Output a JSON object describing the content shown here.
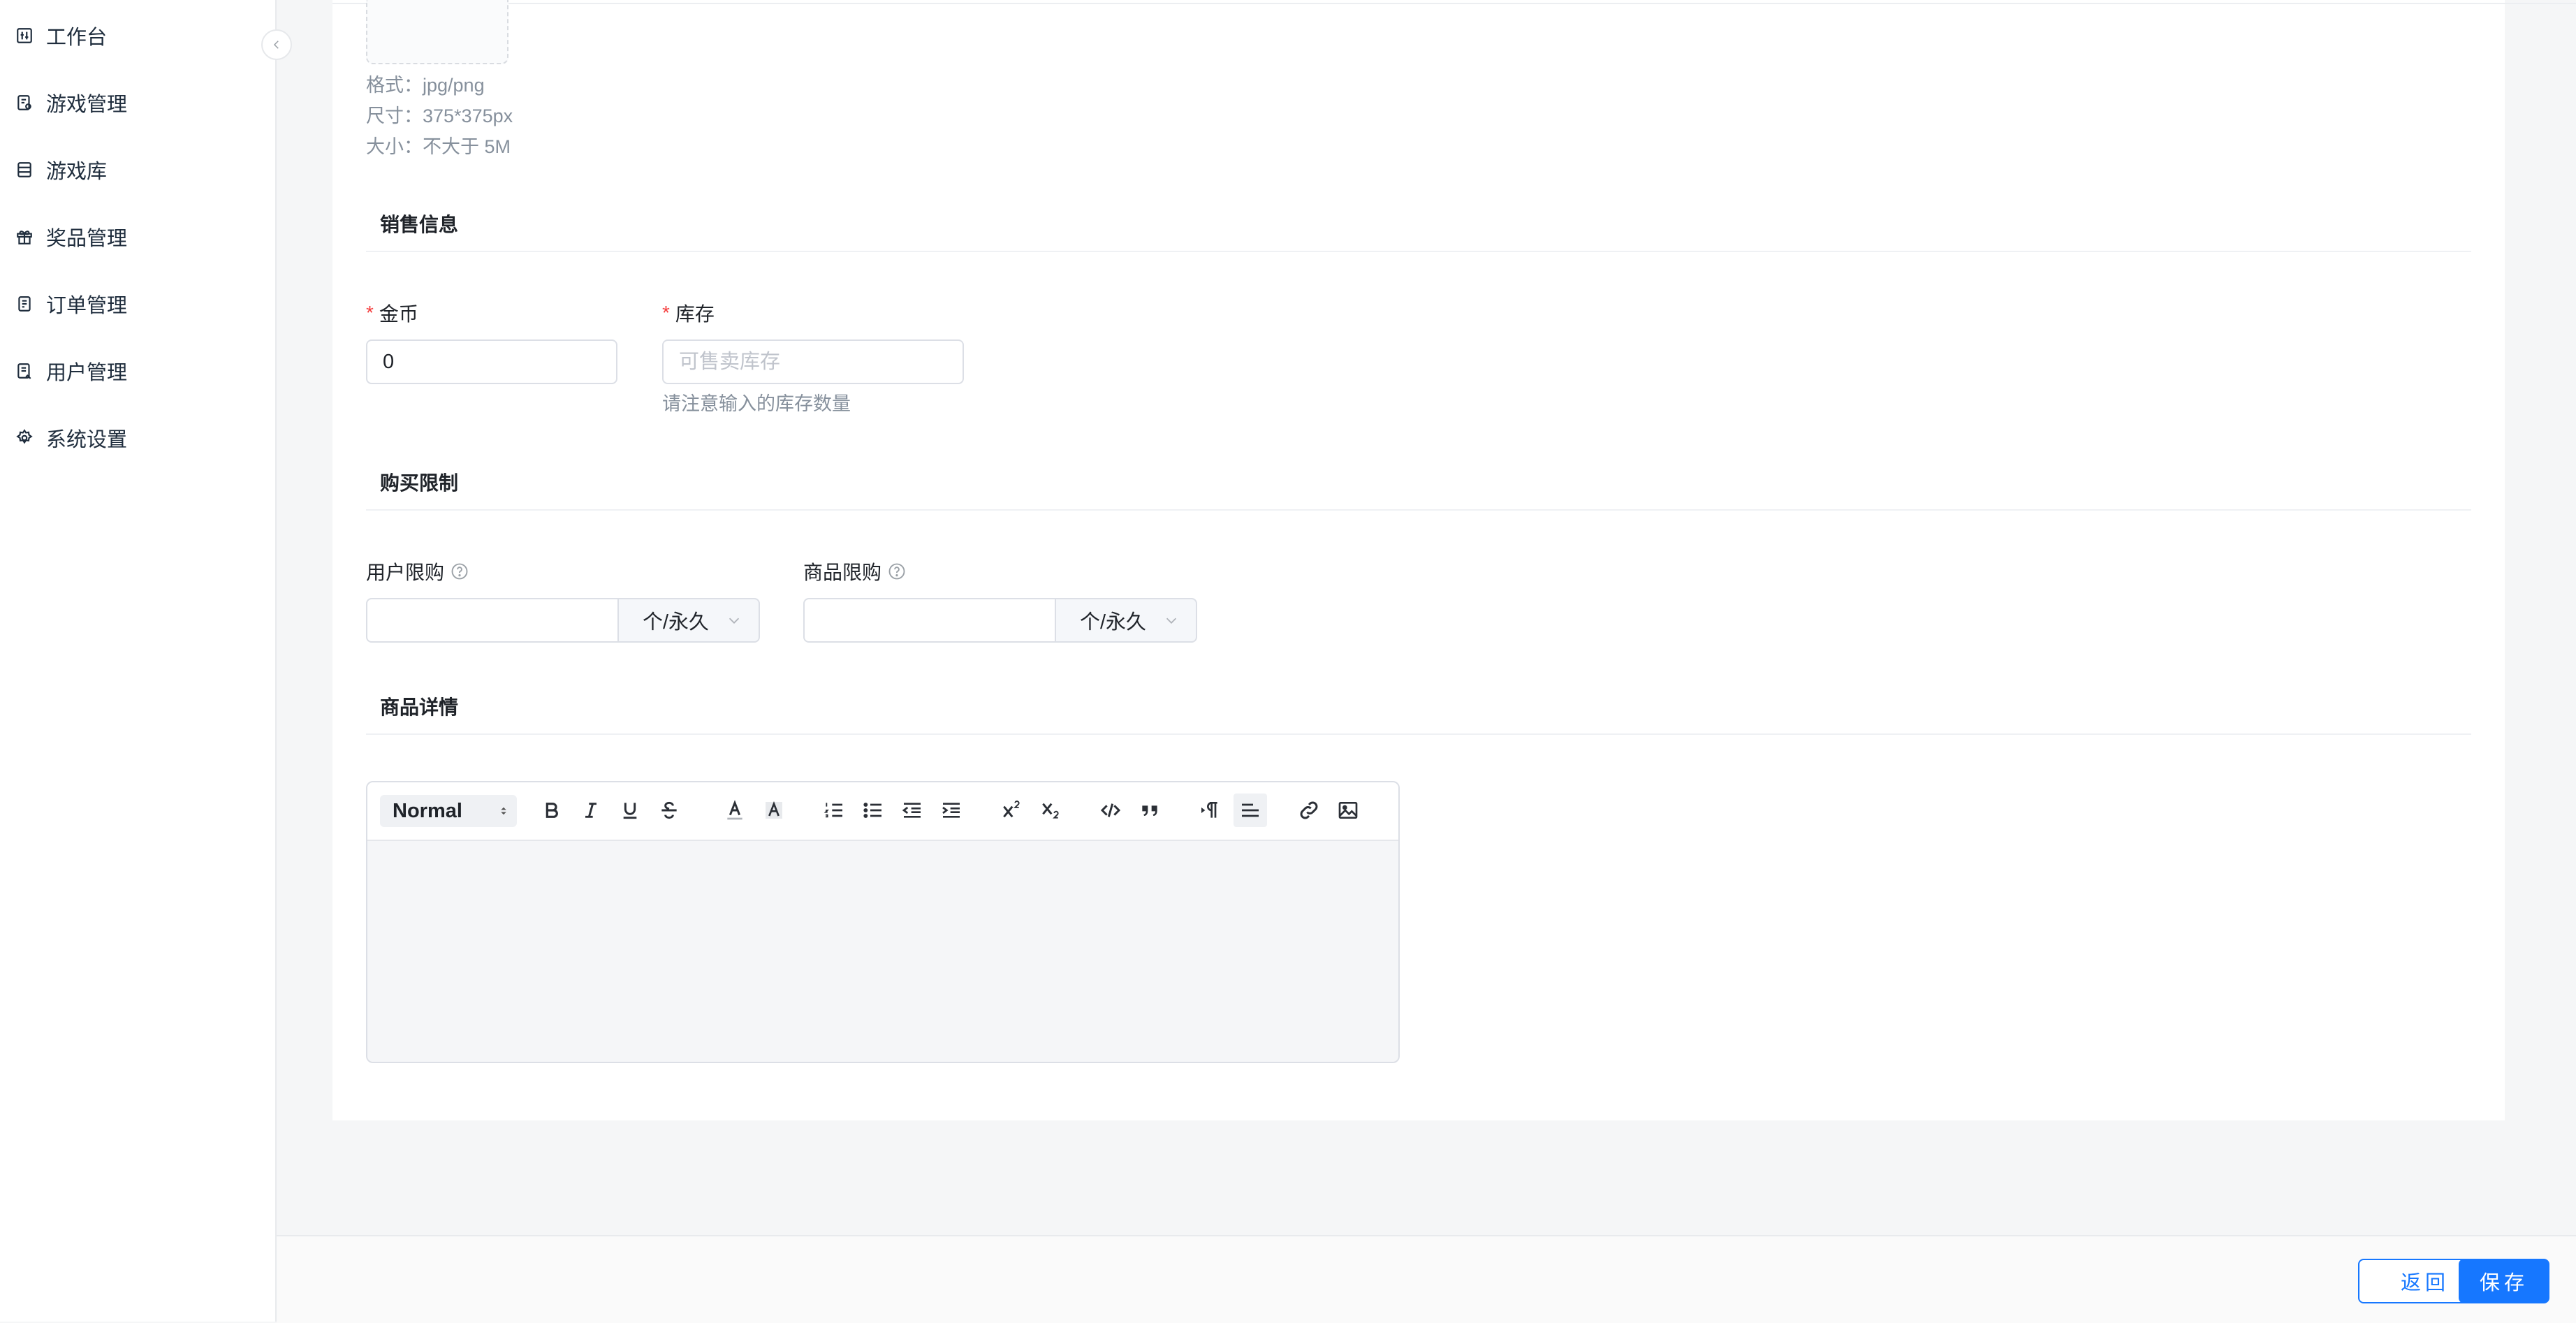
{
  "sidebar": {
    "items": [
      {
        "label": "工作台",
        "icon": "workbench-icon"
      },
      {
        "label": "游戏管理",
        "icon": "game-manage-icon"
      },
      {
        "label": "游戏库",
        "icon": "game-library-icon"
      },
      {
        "label": "奖品管理",
        "icon": "gift-icon"
      },
      {
        "label": "订单管理",
        "icon": "order-icon"
      },
      {
        "label": "用户管理",
        "icon": "user-manage-icon"
      },
      {
        "label": "系统设置",
        "icon": "gear-icon"
      }
    ]
  },
  "image_hints": {
    "format": "格式：jpg/png",
    "size": "尺寸：375*375px",
    "filesize": "大小：不大于 5M"
  },
  "sales": {
    "title": "销售信息",
    "coins_label": "金币",
    "coins_value": "0",
    "stock_label": "库存",
    "stock_placeholder": "可售卖库存",
    "stock_hint": "请注意输入的库存数量"
  },
  "limits": {
    "title": "购买限制",
    "user_label": "用户限购",
    "user_unit": "个/永久",
    "product_label": "商品限购",
    "product_unit": "个/永久"
  },
  "details": {
    "title": "商品详情",
    "heading_select": "Normal"
  },
  "footer": {
    "back_label": "返回",
    "save_label": "保存"
  },
  "colors": {
    "primary": "#1677ff",
    "required": "#f53f3f"
  }
}
